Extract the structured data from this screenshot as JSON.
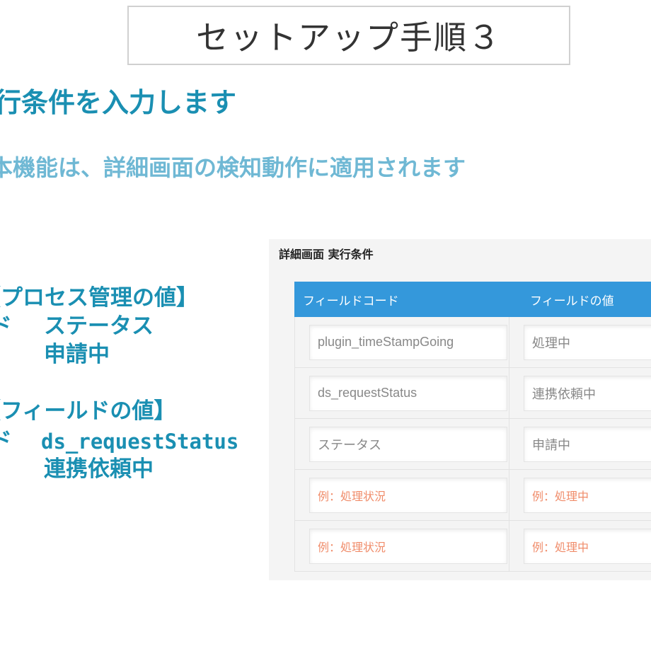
{
  "title": "セットアップ手順３",
  "heading": "行条件を入力します",
  "subheading": "本機能は、詳細画面の検知動作に適用されます",
  "descriptions": [
    {
      "group_label": "【プロセス管理の値】",
      "field_prefix": "ド",
      "field_value": "ステータス",
      "value": "申請中"
    },
    {
      "group_label": "【フィールドの値】",
      "field_prefix": "ド",
      "field_value": "ds_requestStatus",
      "value": "連携依頼中"
    }
  ],
  "panel": {
    "label": "詳細画面 実行条件",
    "table": {
      "headers": [
        "フィールドコード",
        "フィールドの値"
      ],
      "rows": [
        {
          "code": "plugin_timeStampGoing",
          "value": "処理中",
          "placeholder": false
        },
        {
          "code": "ds_requestStatus",
          "value": "連携依頼中",
          "placeholder": false
        },
        {
          "code": "ステータス",
          "value": "申請中",
          "placeholder": false
        },
        {
          "code": "例：処理状況",
          "value": "例：処理中",
          "placeholder": true
        },
        {
          "code": "例：処理状況",
          "value": "例：処理中",
          "placeholder": true
        }
      ]
    }
  },
  "colors": {
    "accent": "#1a8fb2",
    "accent_light": "#6fb8d4",
    "table_header": "#3498db",
    "placeholder": "#f08c6a"
  }
}
